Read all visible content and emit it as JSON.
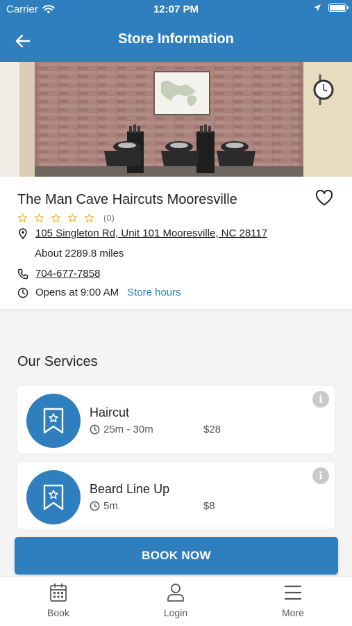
{
  "status_bar": {
    "carrier": "Carrier",
    "time": "12:07 PM"
  },
  "header": {
    "title": "Store Information"
  },
  "store": {
    "name": "The Man Cave Haircuts Mooresville",
    "rating_count": "(0)",
    "rating": 0,
    "address": "105 Singleton Rd, Unit 101 Mooresville, NC 28117",
    "distance": "About 2289.8 miles",
    "phone": "704-677-7858",
    "opens": "Opens at 9:00 AM",
    "store_hours_link": "Store hours"
  },
  "services_section": {
    "title": "Our Services"
  },
  "services": [
    {
      "name": "Haircut",
      "duration": "25m - 30m",
      "price": "$28"
    },
    {
      "name": "Beard Line Up",
      "duration": "5m",
      "price": "$8"
    }
  ],
  "book_button": {
    "label": "BOOK NOW"
  },
  "tabs": [
    {
      "label": "Book",
      "icon": "calendar-icon"
    },
    {
      "label": "Login",
      "icon": "user-icon"
    },
    {
      "label": "More",
      "icon": "menu-icon"
    }
  ],
  "colors": {
    "primary": "#2f7fbf",
    "star": "#f0b429"
  }
}
